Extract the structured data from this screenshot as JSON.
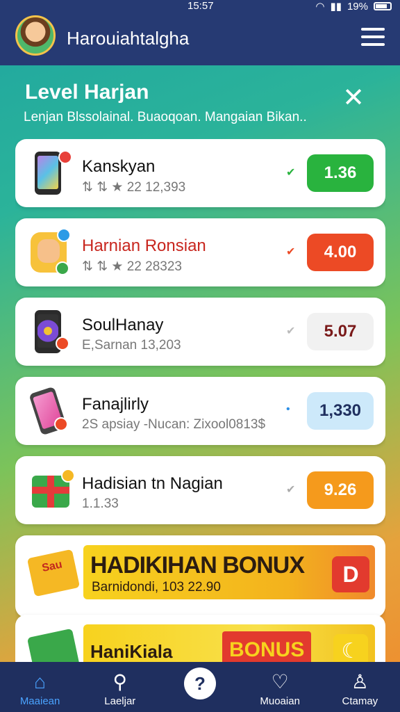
{
  "status": {
    "time": "15:57",
    "battery": "19%"
  },
  "app": {
    "title": "Harouiahtalgha"
  },
  "level": {
    "title": "Level Harjan",
    "subtitle": "Lenjan Blssolainal. Buaoqoan. Mangaian Bikan.."
  },
  "items": [
    {
      "name": "Kanskyan",
      "meta": "⇅ ⇅ ★ 22 12,393",
      "price": "1.36",
      "price_color": "#29b33e",
      "chev_color": "#29b33e",
      "name_color": "#111111"
    },
    {
      "name": "Harnian Ronsian",
      "meta": "⇅ ⇅ ★ 22 28323",
      "price": "4.00",
      "price_color": "#ec4a25",
      "chev_color": "#ec4a25",
      "name_color": "#c8261e"
    },
    {
      "name": "SoulHanay",
      "meta": "E,Sarnan 13,203",
      "price": "5.07",
      "price_color": "#f1f1f1",
      "chev_color": "#bbbbbb",
      "name_color": "#111111",
      "price_text_color": "#7a1a1a"
    },
    {
      "name": "Fanajlirly",
      "meta": "2S apsiay -Nucan: Zixool0813$",
      "price": "1,330",
      "price_color": "#cde9fa",
      "chev_color": "#2b8ee6",
      "name_color": "#111111",
      "price_text_color": "#1f2f5f"
    },
    {
      "name": "Hadisian tn Nagian",
      "meta": "1.1.33",
      "price": "9.26",
      "price_color": "#f59a1c",
      "chev_color": "#aaaaaa",
      "name_color": "#111111"
    }
  ],
  "bonus1": {
    "ticket": "Sau",
    "title": "HADIKIHAN BONUX",
    "subtitle": "Barnidondi, 103 22.90",
    "action": "D"
  },
  "bonus2": {
    "title": "HaniKiala",
    "badge": "BONUS",
    "action": "☾"
  },
  "nav": [
    {
      "label": "Maaiean",
      "icon": "home-icon",
      "glyph": "⌂"
    },
    {
      "label": "Laeljar",
      "icon": "search-icon",
      "glyph": "⚲"
    },
    {
      "label": "",
      "icon": "center-action-icon",
      "glyph": "?"
    },
    {
      "label": "Muoaian",
      "icon": "heart-icon",
      "glyph": "♡"
    },
    {
      "label": "Ctamay",
      "icon": "profile-icon",
      "glyph": "♙"
    }
  ]
}
